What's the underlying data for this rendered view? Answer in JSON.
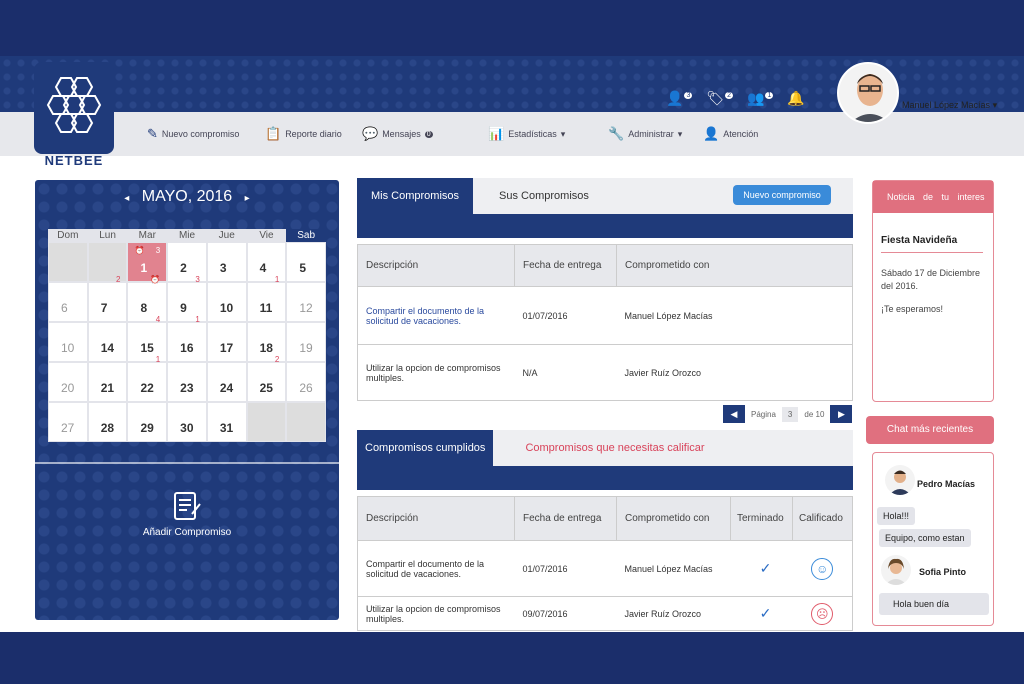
{
  "brand": {
    "name": "NETBEE"
  },
  "header": {
    "badges": [
      {
        "icon": "user-icon",
        "count": "3"
      },
      {
        "icon": "tag-icon",
        "count": "2"
      },
      {
        "icon": "group-icon",
        "count": "1"
      },
      {
        "icon": "bell-icon",
        "count": ""
      }
    ],
    "username": "Manuel López Macías"
  },
  "menu": [
    {
      "icon": "edit-doc-icon",
      "label": "Nuevo compromiso"
    },
    {
      "icon": "clipboard-icon",
      "label": "Reporte diario"
    },
    {
      "icon": "chat-icon",
      "label": "Mensajes",
      "badge": "0"
    },
    {
      "icon": "bar-chart-icon",
      "label": "Estadísticas"
    },
    {
      "icon": "wrench-icon",
      "label": "Administrar"
    },
    {
      "icon": "person-icon",
      "label": "Atención"
    }
  ],
  "calendar": {
    "title": "MAYO, 2016",
    "days": [
      "Dom",
      "Lun",
      "Mar",
      "Mie",
      "Jue",
      "Vie",
      "Sab"
    ],
    "weeks": [
      [
        {
          "n": "",
          "s": "grey"
        },
        {
          "n": "",
          "s": "grey"
        },
        {
          "n": "1",
          "s": "sel",
          "bl": "⏰",
          "b": "3"
        },
        {
          "n": "2"
        },
        {
          "n": "3"
        },
        {
          "n": "4"
        },
        {
          "n": "5"
        }
      ],
      [
        {
          "n": "6",
          "s": "light",
          "b": ""
        },
        {
          "n": "7",
          "bt": "2"
        },
        {
          "n": "8",
          "bt": "⏰"
        },
        {
          "n": "9",
          "bt": "3"
        },
        {
          "n": "10"
        },
        {
          "n": "11",
          "bt": "1"
        },
        {
          "n": "12",
          "s": "light"
        }
      ],
      [
        {
          "n": "10",
          "s": "light"
        },
        {
          "n": "14"
        },
        {
          "n": "15",
          "bt": "4"
        },
        {
          "n": "16",
          "bt": "1"
        },
        {
          "n": "17"
        },
        {
          "n": "18"
        },
        {
          "n": "19",
          "s": "light"
        }
      ],
      [
        {
          "n": "20",
          "s": "light"
        },
        {
          "n": "21"
        },
        {
          "n": "22",
          "bt": "1"
        },
        {
          "n": "23"
        },
        {
          "n": "24"
        },
        {
          "n": "25",
          "bt": "2"
        },
        {
          "n": "26",
          "s": "light"
        }
      ],
      [
        {
          "n": "27",
          "s": "light"
        },
        {
          "n": "28"
        },
        {
          "n": "29"
        },
        {
          "n": "30"
        },
        {
          "n": "31"
        },
        {
          "n": "",
          "s": "grey"
        },
        {
          "n": "",
          "s": "grey"
        }
      ]
    ],
    "add_label": "Añadir Compromiso"
  },
  "panel1": {
    "tab_active": "Mis Compromisos",
    "tab_inactive": "Sus Compromisos",
    "button": "Nuevo compromiso",
    "headers": [
      "Descripción",
      "Fecha de entrega",
      "Comprometido con"
    ],
    "rows": [
      [
        "Compartir el documento de la solicitud de vacaciones.",
        "01/07/2016",
        "Manuel López Macías"
      ],
      [
        "Utilizar la opcion de compromisos multiples.",
        "N/A",
        "Javier Ruíz Orozco"
      ]
    ],
    "pager": {
      "label": "Página",
      "page": "3",
      "of": "de 10"
    }
  },
  "panel2": {
    "tab_active": "Compromisos cumplidos",
    "tab_inactive": "Compromisos que necesitas calificar",
    "headers": [
      "Descripción",
      "Fecha de entrega",
      "Comprometido con",
      "Terminado",
      "Calificado"
    ],
    "rows": [
      [
        "Compartir el documento de la solicitud de vacaciones.",
        "01/07/2016",
        "Manuel López Macías",
        "✓",
        "☺"
      ],
      [
        "Utilizar la opcion de compromisos multiples.",
        "09/07/2016",
        "Javier Ruíz Orozco",
        "✓",
        "☹"
      ]
    ],
    "colors": {
      "happy": "#3a8bd9",
      "sad": "#e05a6a"
    }
  },
  "notice": {
    "header": "Noticia de tu interes",
    "title": "Fiesta Navideña",
    "date": "Sábado 17 de Diciembre del 2016.",
    "text": "¡Te esperamos!"
  },
  "chat": {
    "header": "Chat más recientes",
    "items": [
      {
        "name": "Pedro Macías",
        "msgs": [
          "Hola!!!",
          "Equipo, como estan"
        ]
      },
      {
        "name": "Sofia Pinto",
        "msgs": [
          "Hola buen día"
        ]
      }
    ]
  }
}
